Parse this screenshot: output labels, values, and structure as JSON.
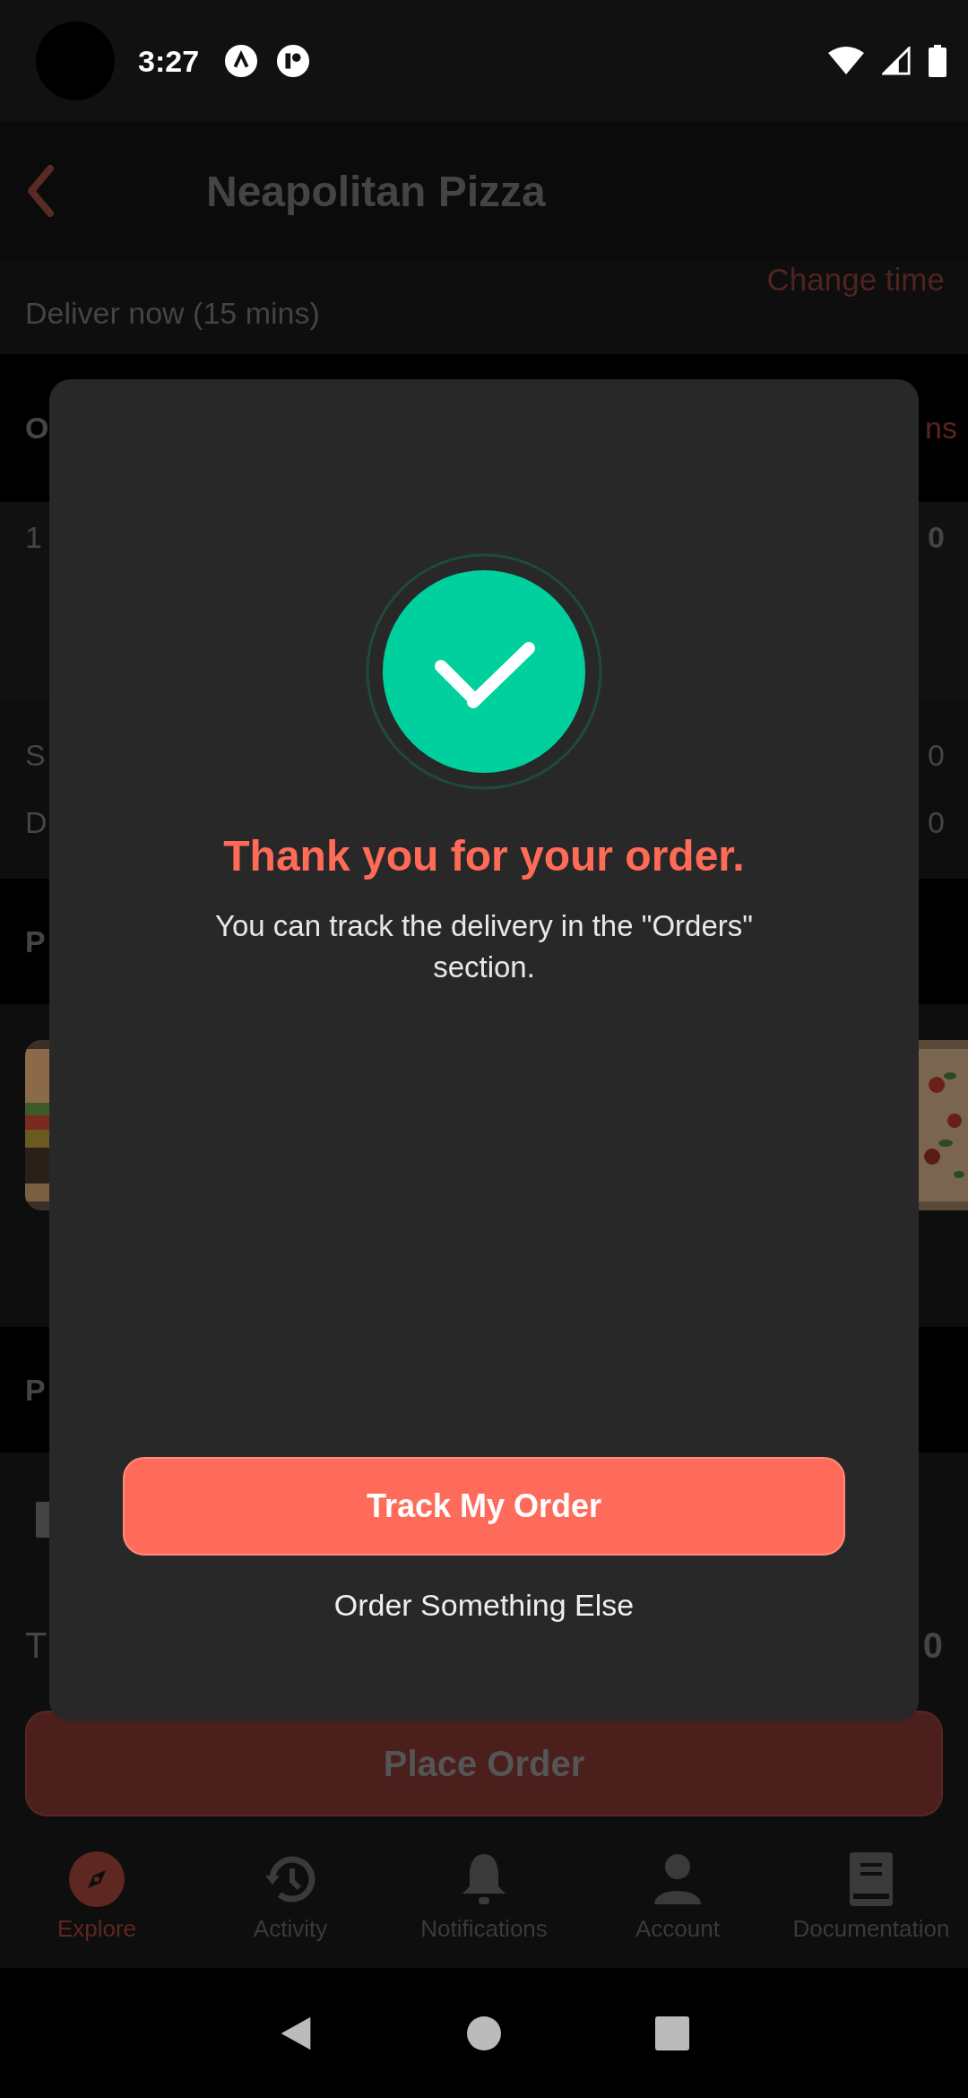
{
  "status_bar": {
    "time": "3:27"
  },
  "header": {
    "title": "Neapolitan Pizza"
  },
  "delivery": {
    "label": "Deliver now (15 mins)",
    "action": "Change time"
  },
  "order_section": {
    "heading": "O",
    "action": "ns",
    "item_quantity": "1",
    "item_price": "0",
    "subtotal_label": "S",
    "subtotal_value": "0",
    "fee_label": "D",
    "fee_value": "0"
  },
  "pictures_section": {
    "heading": "P"
  },
  "payment_section": {
    "heading": "P"
  },
  "total": {
    "label": "T",
    "value": "0"
  },
  "place_order_button": "Place Order",
  "dialog": {
    "title": "Thank you for your order.",
    "message": "You can track the delivery in the \"Orders\" section.",
    "primary_button": "Track My Order",
    "secondary_button": "Order Something Else"
  },
  "tabs": [
    {
      "label": "Explore",
      "kind": "compass",
      "selected": true
    },
    {
      "label": "Activity",
      "kind": "history",
      "selected": false
    },
    {
      "label": "Notifications",
      "kind": "bell",
      "selected": false
    },
    {
      "label": "Account",
      "kind": "person",
      "selected": false
    },
    {
      "label": "Documentation",
      "kind": "book",
      "selected": false
    }
  ]
}
